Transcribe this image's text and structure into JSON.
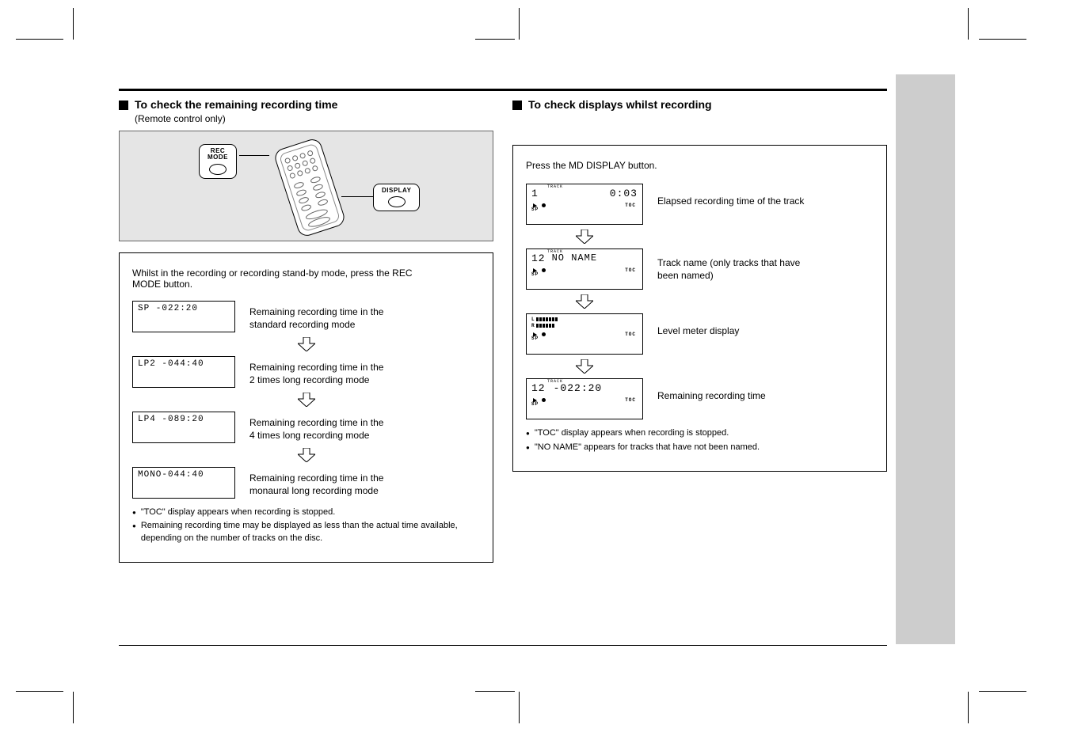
{
  "left": {
    "title": "To check the remaining recording time",
    "subtitle": "(Remote control only)",
    "instruction_line1": "Whilst in the recording or recording stand-by mode, press the REC",
    "instruction_line2": "MODE button.",
    "lcd1": "SP -022:20",
    "lcd1_desc1": "Remaining recording time in the",
    "lcd1_desc2": "standard recording mode",
    "lcd2": "LP2 -044:40",
    "lcd2_desc1": "Remaining recording time in the",
    "lcd2_desc2": "2 times long recording mode",
    "lcd3": "LP4 -089:20",
    "lcd3_desc1": "Remaining recording time in the",
    "lcd3_desc2": "4 times long recording mode",
    "lcd4": "MONO-044:40",
    "lcd4_desc1": "Remaining recording time in the",
    "lcd4_desc2": "monaural long recording mode",
    "bullet1": "\"TOC\" display appears when recording is stopped.",
    "bullet2": "Remaining recording time may be displayed as less than the actual time available, depending on the number of tracks on the disc.",
    "btn_rec_line1": "REC",
    "btn_rec_line2": "MODE",
    "btn_display": "DISPLAY"
  },
  "right": {
    "title": "To check displays whilst recording",
    "instruction": "Press the MD DISPLAY button.",
    "lcd1_left": "1",
    "lcd1_right": "0:03",
    "lcd1_tag": "TRACK",
    "lcd1_desc": "Elapsed recording time of the track",
    "lcd2_left": "12",
    "lcd2_right": "NO NAME",
    "lcd2_tag": "TRACK",
    "lcd2_desc1": "Track name (only tracks that have",
    "lcd2_desc2": "been named)",
    "lcd3_desc": "Level meter display",
    "lcd4_left": "12",
    "lcd4_right": "-022:20",
    "lcd4_tag": "TRACK",
    "lcd4_desc": "Remaining recording time",
    "bullet1": "\"TOC\" display appears when recording is stopped.",
    "bullet2": "\"NO NAME\" appears for tracks that have not been named.",
    "sp_label": "SP",
    "toc_label": "TOC"
  }
}
